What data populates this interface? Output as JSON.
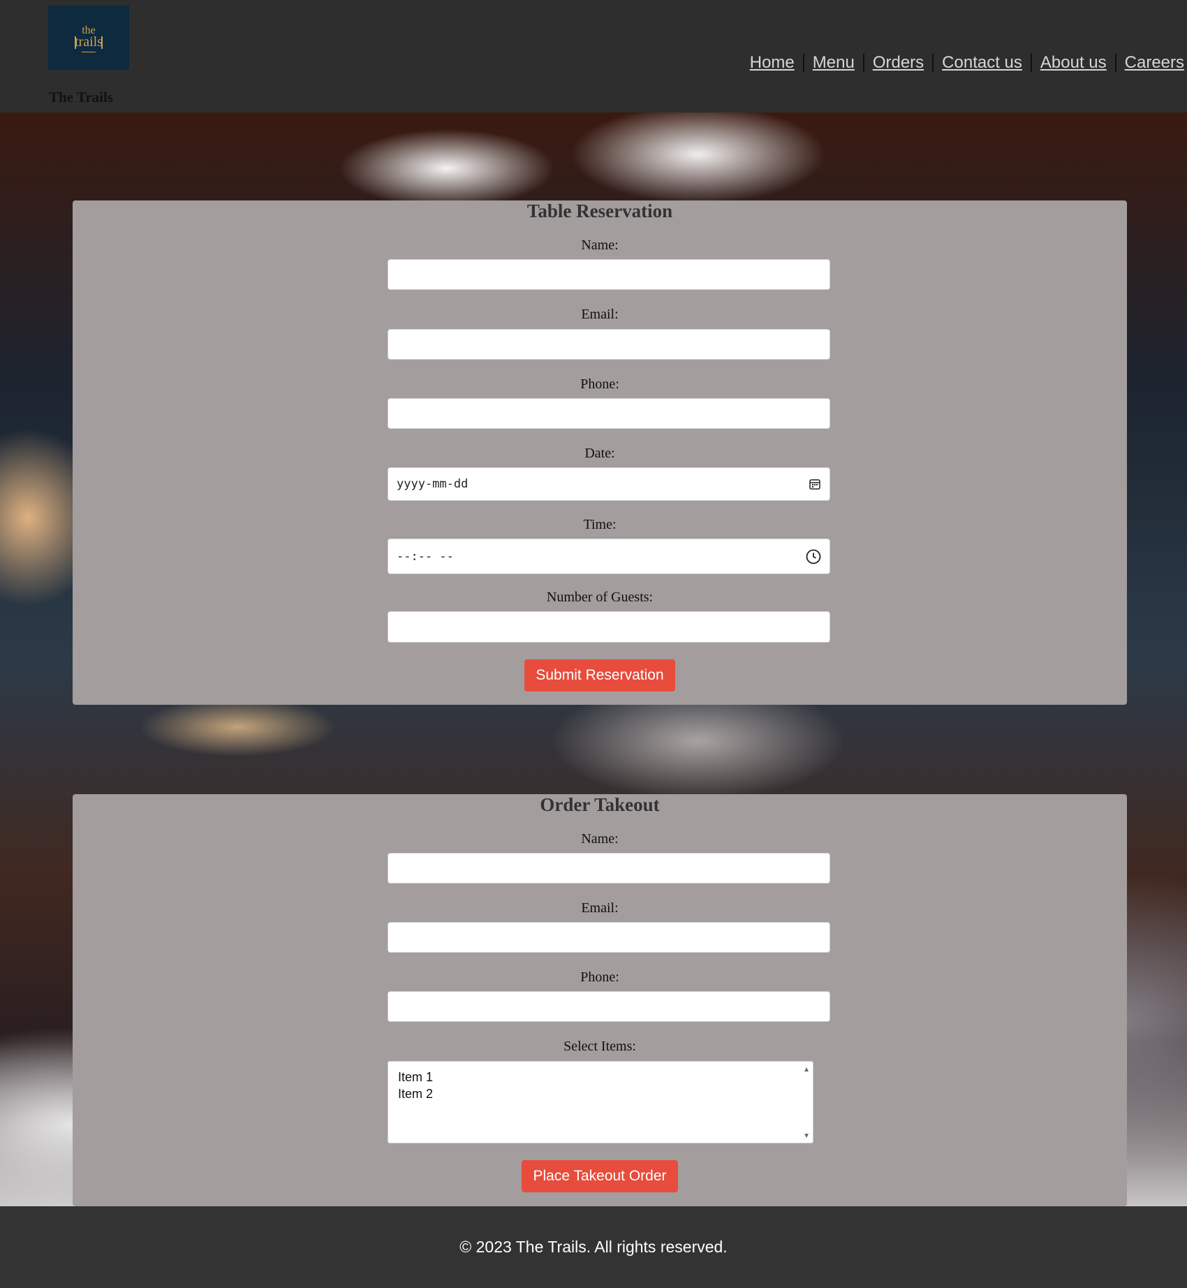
{
  "header": {
    "logo_text": "the trails",
    "site_name": "The Trails",
    "nav": [
      "Home",
      "Menu",
      "Orders",
      "Contact us",
      "About us",
      "Careers"
    ]
  },
  "reservation": {
    "title": "Table Reservation",
    "name_label": "Name:",
    "email_label": "Email:",
    "phone_label": "Phone:",
    "date_label": "Date:",
    "date_placeholder": "yyyy-mm-dd",
    "time_label": "Time:",
    "time_placeholder": "--:-- --",
    "guests_label": "Number of Guests:",
    "submit_label": "Submit Reservation"
  },
  "takeout": {
    "title": "Order Takeout",
    "name_label": "Name:",
    "email_label": "Email:",
    "phone_label": "Phone:",
    "items_label": "Select Items:",
    "items": [
      "Item 1",
      "Item 2"
    ],
    "submit_label": "Place Takeout Order"
  },
  "footer": {
    "text": "© 2023 The Trails. All rights reserved."
  },
  "colors": {
    "header_bg": "#2f2e2e",
    "card_bg": "#a39d9d",
    "button": "#e74c3c",
    "logo_bg": "#0e2a3f",
    "logo_gold": "#c9a24a"
  }
}
